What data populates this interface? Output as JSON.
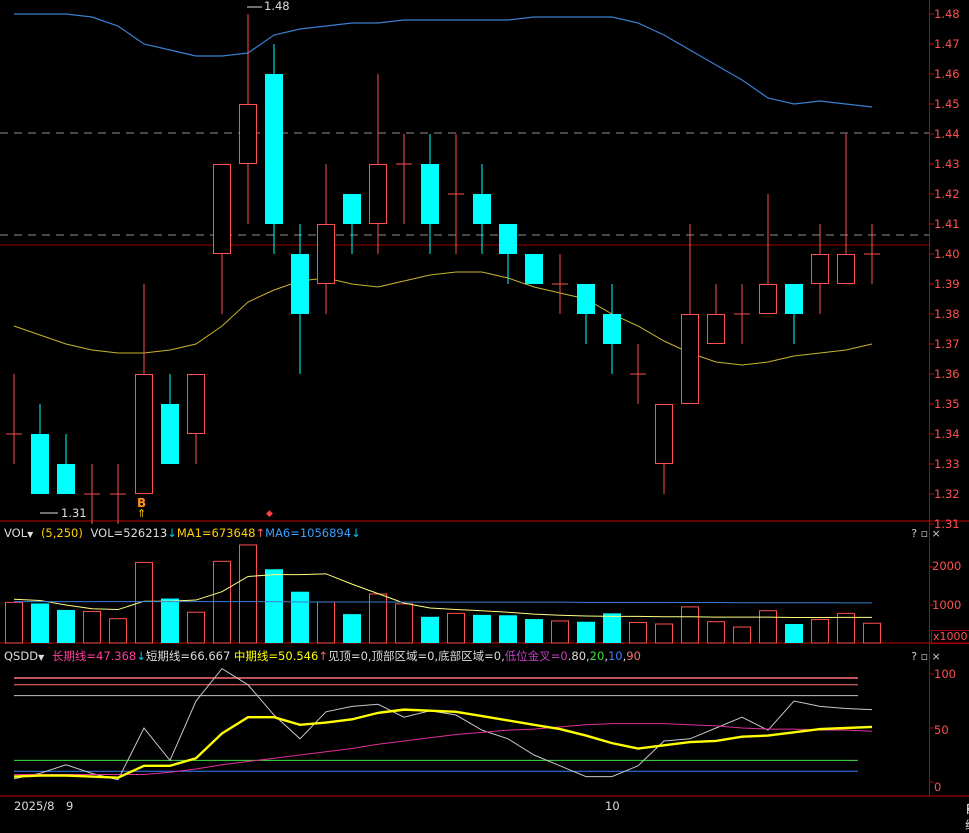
{
  "price_axis": [
    "1.48",
    "1.47",
    "1.46",
    "1.45",
    "1.44",
    "1.43",
    "1.42",
    "1.41",
    "1.40",
    "1.39",
    "1.38",
    "1.37",
    "1.36",
    "1.35",
    "1.34",
    "1.33",
    "1.32",
    "1.31"
  ],
  "price_markers": {
    "high": "1.48",
    "low": "1.31",
    "buy_signal": "B"
  },
  "vol_panel": {
    "selector": "VOL",
    "params": "(5,250)",
    "vol_label": "VOL=526213",
    "vol_arrow": "↓",
    "ma1_label": "MA1=673648",
    "ma1_arrow": "↑",
    "ma6_label": "MA6=1056894",
    "ma6_arrow": "↓",
    "axis": [
      "2000",
      "1000"
    ],
    "unit": "x1000",
    "buttons": "? ▫ ×"
  },
  "qsdd_panel": {
    "selector": "QSDD",
    "long_label": "长期线=47.368",
    "long_arrow": "↓",
    "short_label": "短期线=66.667",
    "mid_label": "中期线=50.546",
    "mid_arrow": "↑",
    "top_label": "见顶=0",
    "top_zone": "顶部区域=0",
    "bottom_zone": "底部区域=0",
    "gold_label": "低位金叉=0",
    "extra": [
      "80",
      "20",
      "10",
      "90"
    ],
    "axis": [
      "100",
      "50",
      "0"
    ],
    "buttons": "? ▫ ×"
  },
  "date_axis": {
    "start": "2025/8",
    "m9": "9",
    "m10": "10",
    "toggle": "日线"
  },
  "colors": {
    "up": "#ff5050",
    "down": "#00ffff",
    "ma_price": "#c8b430",
    "bb": "#3a7fd0",
    "axis": "#c00000"
  },
  "chart_data": {
    "type": "candlestick",
    "candles": [
      {
        "o": 1.34,
        "h": 1.36,
        "l": 1.33,
        "c": 1.34
      },
      {
        "o": 1.34,
        "h": 1.35,
        "l": 1.32,
        "c": 1.32
      },
      {
        "o": 1.33,
        "h": 1.34,
        "l": 1.32,
        "c": 1.32
      },
      {
        "o": 1.32,
        "h": 1.33,
        "l": 1.31,
        "c": 1.32
      },
      {
        "o": 1.32,
        "h": 1.33,
        "l": 1.31,
        "c": 1.32
      },
      {
        "o": 1.32,
        "h": 1.39,
        "l": 1.32,
        "c": 1.36
      },
      {
        "o": 1.35,
        "h": 1.36,
        "l": 1.33,
        "c": 1.33
      },
      {
        "o": 1.34,
        "h": 1.36,
        "l": 1.33,
        "c": 1.36
      },
      {
        "o": 1.4,
        "h": 1.43,
        "l": 1.38,
        "c": 1.43
      },
      {
        "o": 1.43,
        "h": 1.48,
        "l": 1.41,
        "c": 1.45
      },
      {
        "o": 1.46,
        "h": 1.47,
        "l": 1.4,
        "c": 1.41
      },
      {
        "o": 1.4,
        "h": 1.41,
        "l": 1.36,
        "c": 1.38
      },
      {
        "o": 1.39,
        "h": 1.43,
        "l": 1.38,
        "c": 1.41
      },
      {
        "o": 1.42,
        "h": 1.42,
        "l": 1.4,
        "c": 1.41
      },
      {
        "o": 1.41,
        "h": 1.46,
        "l": 1.4,
        "c": 1.43
      },
      {
        "o": 1.43,
        "h": 1.44,
        "l": 1.41,
        "c": 1.43
      },
      {
        "o": 1.43,
        "h": 1.44,
        "l": 1.4,
        "c": 1.41
      },
      {
        "o": 1.42,
        "h": 1.44,
        "l": 1.4,
        "c": 1.42
      },
      {
        "o": 1.42,
        "h": 1.43,
        "l": 1.4,
        "c": 1.41
      },
      {
        "o": 1.41,
        "h": 1.41,
        "l": 1.39,
        "c": 1.4
      },
      {
        "o": 1.4,
        "h": 1.4,
        "l": 1.39,
        "c": 1.39
      },
      {
        "o": 1.39,
        "h": 1.4,
        "l": 1.38,
        "c": 1.39
      },
      {
        "o": 1.39,
        "h": 1.39,
        "l": 1.37,
        "c": 1.38
      },
      {
        "o": 1.38,
        "h": 1.39,
        "l": 1.36,
        "c": 1.37
      },
      {
        "o": 1.36,
        "h": 1.37,
        "l": 1.35,
        "c": 1.36
      },
      {
        "o": 1.33,
        "h": 1.35,
        "l": 1.32,
        "c": 1.35
      },
      {
        "o": 1.35,
        "h": 1.41,
        "l": 1.35,
        "c": 1.38
      },
      {
        "o": 1.37,
        "h": 1.39,
        "l": 1.37,
        "c": 1.38
      },
      {
        "o": 1.38,
        "h": 1.39,
        "l": 1.37,
        "c": 1.38
      },
      {
        "o": 1.38,
        "h": 1.42,
        "l": 1.38,
        "c": 1.39
      },
      {
        "o": 1.39,
        "h": 1.39,
        "l": 1.37,
        "c": 1.38
      },
      {
        "o": 1.39,
        "h": 1.41,
        "l": 1.38,
        "c": 1.4
      },
      {
        "o": 1.39,
        "h": 1.44,
        "l": 1.39,
        "c": 1.4
      },
      {
        "o": 1.4,
        "h": 1.41,
        "l": 1.39,
        "c": 1.4
      }
    ],
    "ma_line": [
      1.376,
      1.373,
      1.37,
      1.368,
      1.367,
      1.367,
      1.368,
      1.37,
      1.376,
      1.384,
      1.388,
      1.391,
      1.392,
      1.39,
      1.389,
      1.391,
      1.393,
      1.394,
      1.394,
      1.392,
      1.389,
      1.387,
      1.385,
      1.38,
      1.376,
      1.371,
      1.367,
      1.364,
      1.363,
      1.364,
      1.366,
      1.367,
      1.368,
      1.37
    ],
    "bb_upper": [
      1.48,
      1.48,
      1.48,
      1.479,
      1.476,
      1.47,
      1.468,
      1.466,
      1.466,
      1.467,
      1.473,
      1.475,
      1.476,
      1.477,
      1.477,
      1.478,
      1.478,
      1.478,
      1.478,
      1.478,
      1.479,
      1.479,
      1.479,
      1.479,
      1.477,
      1.473,
      1.468,
      1.463,
      1.458,
      1.452,
      1.45,
      1.451,
      1.45,
      1.449
    ],
    "volume": [
      1070,
      1040,
      870,
      830,
      640,
      2120,
      1170,
      810,
      2150,
      2580,
      1940,
      1350,
      1080,
      760,
      1290,
      1030,
      690,
      780,
      740,
      730,
      630,
      580,
      560,
      780,
      540,
      500,
      950,
      560,
      420,
      850,
      500,
      620,
      780,
      520
    ],
    "vol_ma1": [
      1150,
      1120,
      1000,
      900,
      880,
      1100,
      1100,
      1130,
      1350,
      1750,
      1800,
      1800,
      1820,
      1550,
      1300,
      1050,
      920,
      880,
      850,
      810,
      760,
      730,
      710,
      700,
      700,
      690,
      690,
      680,
      680,
      680,
      670,
      670,
      674,
      674
    ],
    "vol_ma6": [
      1090,
      1090,
      1090,
      1090,
      1090,
      1090,
      1090,
      1090,
      1090,
      1090,
      1090,
      1080,
      1080,
      1080,
      1080,
      1075,
      1075,
      1075,
      1075,
      1075,
      1075,
      1075,
      1070,
      1070,
      1070,
      1070,
      1065,
      1065,
      1060,
      1060,
      1060,
      1058,
      1057,
      1057
    ],
    "qsdd_short": [
      3,
      8,
      16,
      8,
      2,
      50,
      20,
      75,
      105,
      90,
      62,
      40,
      65,
      70,
      72,
      60,
      66,
      62,
      48,
      40,
      25,
      15,
      5,
      5,
      15,
      38,
      40,
      50,
      60,
      48,
      75,
      70,
      68,
      67
    ],
    "qsdd_mid": [
      5,
      6,
      6,
      5,
      4,
      15,
      15,
      22,
      45,
      60,
      60,
      53,
      55,
      58,
      64,
      67,
      66,
      65,
      61,
      57,
      53,
      49,
      43,
      36,
      31,
      34,
      37,
      38,
      42,
      43,
      46,
      49,
      50,
      51
    ],
    "qsdd_long": [
      7,
      7,
      7,
      7,
      7,
      7,
      9,
      12,
      16,
      19,
      22,
      25,
      28,
      31,
      35,
      38,
      41,
      44,
      46,
      48,
      49,
      51,
      53,
      54,
      54,
      54,
      53,
      52,
      50,
      49,
      49,
      48,
      48,
      47
    ]
  }
}
